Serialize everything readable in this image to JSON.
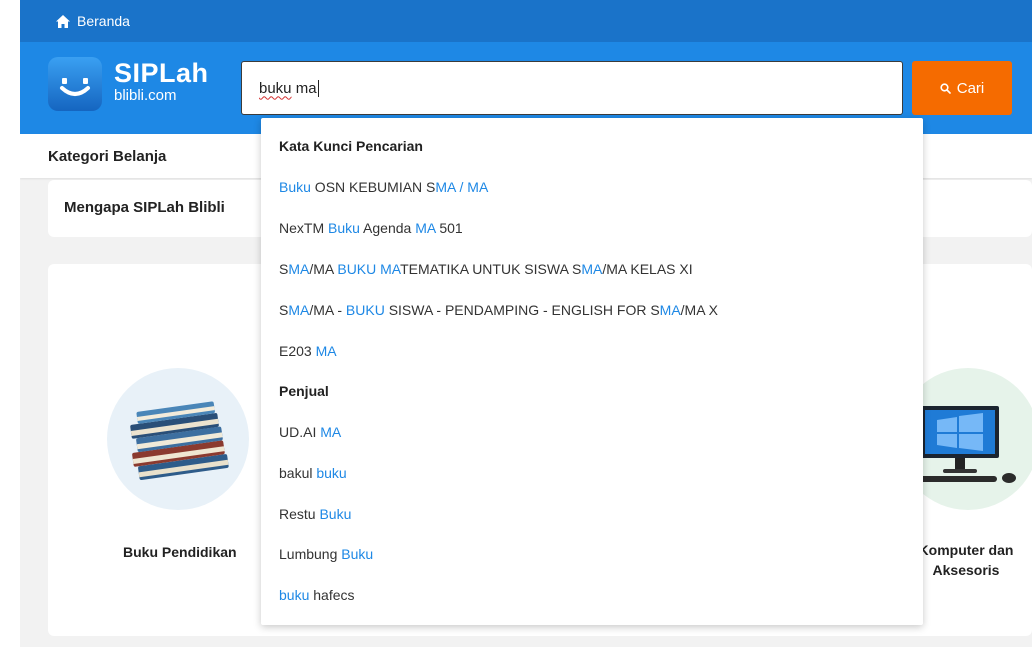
{
  "topbar": {
    "home_label": "Beranda"
  },
  "header": {
    "logo_title": "SIPLah",
    "logo_sub": "blibli.com",
    "search_value_kw": "buku",
    "search_value_rest": " ma",
    "search_button": "Cari"
  },
  "category_bar": {
    "label": "Kategori Belanja"
  },
  "why_card": {
    "label": "Mengapa SIPLah Blibli"
  },
  "categories": [
    {
      "label": "Buku Pendidikan",
      "icon": "books-icon"
    },
    {
      "label": "Komputer dan Aksesoris",
      "icon": "computer-icon"
    }
  ],
  "suggestions": {
    "keyword_heading": "Kata Kunci Pencarian",
    "keywords": [
      [
        {
          "t": "Buku",
          "h": true
        },
        {
          "t": " OSN KEBUMIAN S",
          "h": false
        },
        {
          "t": "MA / MA",
          "h": true
        }
      ],
      [
        {
          "t": "NexTM ",
          "h": false
        },
        {
          "t": "Buku",
          "h": true
        },
        {
          "t": " Agenda ",
          "h": false
        },
        {
          "t": "MA",
          "h": true
        },
        {
          "t": " 501",
          "h": false
        }
      ],
      [
        {
          "t": "S",
          "h": false
        },
        {
          "t": "MA",
          "h": true
        },
        {
          "t": "/MA ",
          "h": false
        },
        {
          "t": "BUKU MA",
          "h": true
        },
        {
          "t": "TEMATIKA UNTUK SISWA S",
          "h": false
        },
        {
          "t": "MA",
          "h": true
        },
        {
          "t": "/MA KELAS XI",
          "h": false
        }
      ],
      [
        {
          "t": "S",
          "h": false
        },
        {
          "t": "MA",
          "h": true
        },
        {
          "t": "/MA - ",
          "h": false
        },
        {
          "t": "BUKU",
          "h": true
        },
        {
          "t": " SISWA - PENDAMPING - ENGLISH FOR S",
          "h": false
        },
        {
          "t": "MA",
          "h": true
        },
        {
          "t": "/MA X",
          "h": false
        }
      ],
      [
        {
          "t": "E203 ",
          "h": false
        },
        {
          "t": "MA",
          "h": true
        }
      ]
    ],
    "seller_heading": "Penjual",
    "sellers": [
      [
        {
          "t": "UD.AI ",
          "h": false
        },
        {
          "t": "MA",
          "h": true
        }
      ],
      [
        {
          "t": "bakul ",
          "h": false
        },
        {
          "t": "buku",
          "h": true
        }
      ],
      [
        {
          "t": "Restu ",
          "h": false
        },
        {
          "t": "Buku",
          "h": true
        }
      ],
      [
        {
          "t": "Lumbung ",
          "h": false
        },
        {
          "t": "Buku",
          "h": true
        }
      ],
      [
        {
          "t": "buku",
          "h": true
        },
        {
          "t": " hafecs",
          "h": false
        }
      ]
    ]
  },
  "colors": {
    "topbar": "#1a73c9",
    "header": "#1e88e5",
    "accent_button": "#f56b00",
    "highlight": "#1e88e5"
  }
}
